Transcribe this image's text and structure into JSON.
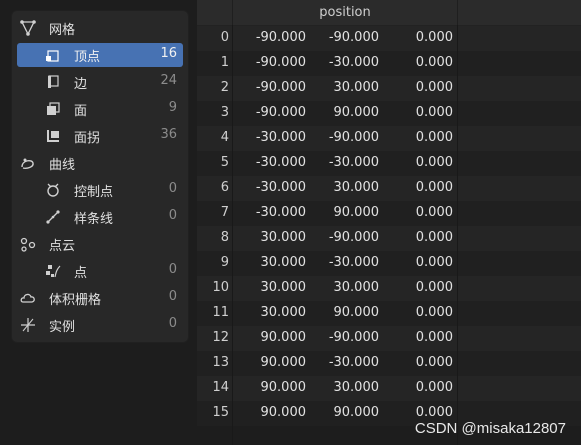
{
  "tree": [
    {
      "key": "mesh",
      "label": "网格",
      "count": "",
      "indent": 0,
      "icon": "mesh-icon",
      "selected": false
    },
    {
      "key": "vertex",
      "label": "顶点",
      "count": "16",
      "indent": 1,
      "icon": "vertex-icon",
      "selected": true
    },
    {
      "key": "edge",
      "label": "边",
      "count": "24",
      "indent": 1,
      "icon": "edge-icon",
      "selected": false
    },
    {
      "key": "face",
      "label": "面",
      "count": "9",
      "indent": 1,
      "icon": "face-icon",
      "selected": false
    },
    {
      "key": "face_corner",
      "label": "面拐",
      "count": "36",
      "indent": 1,
      "icon": "face-corner-icon",
      "selected": false
    },
    {
      "key": "curve",
      "label": "曲线",
      "count": "",
      "indent": 0,
      "icon": "curve-icon",
      "selected": false
    },
    {
      "key": "control_point",
      "label": "控制点",
      "count": "0",
      "indent": 1,
      "icon": "control-point-icon",
      "selected": false
    },
    {
      "key": "spline",
      "label": "样条线",
      "count": "0",
      "indent": 1,
      "icon": "spline-icon",
      "selected": false
    },
    {
      "key": "point_cloud",
      "label": "点云",
      "count": "",
      "indent": 0,
      "icon": "point-cloud-icon",
      "selected": false
    },
    {
      "key": "point",
      "label": "点",
      "count": "0",
      "indent": 1,
      "icon": "point-icon",
      "selected": false
    },
    {
      "key": "volume_grid",
      "label": "体积栅格",
      "count": "0",
      "indent": 0,
      "icon": "volume-icon",
      "selected": false
    },
    {
      "key": "instance",
      "label": "实例",
      "count": "0",
      "indent": 0,
      "icon": "instance-icon",
      "selected": false
    }
  ],
  "table": {
    "header": "position",
    "rows": [
      {
        "i": "0",
        "x": "-90.000",
        "y": "-90.000",
        "z": "0.000"
      },
      {
        "i": "1",
        "x": "-90.000",
        "y": "-30.000",
        "z": "0.000"
      },
      {
        "i": "2",
        "x": "-90.000",
        "y": "30.000",
        "z": "0.000"
      },
      {
        "i": "3",
        "x": "-90.000",
        "y": "90.000",
        "z": "0.000"
      },
      {
        "i": "4",
        "x": "-30.000",
        "y": "-90.000",
        "z": "0.000"
      },
      {
        "i": "5",
        "x": "-30.000",
        "y": "-30.000",
        "z": "0.000"
      },
      {
        "i": "6",
        "x": "-30.000",
        "y": "30.000",
        "z": "0.000"
      },
      {
        "i": "7",
        "x": "-30.000",
        "y": "90.000",
        "z": "0.000"
      },
      {
        "i": "8",
        "x": "30.000",
        "y": "-90.000",
        "z": "0.000"
      },
      {
        "i": "9",
        "x": "30.000",
        "y": "-30.000",
        "z": "0.000"
      },
      {
        "i": "10",
        "x": "30.000",
        "y": "30.000",
        "z": "0.000"
      },
      {
        "i": "11",
        "x": "30.000",
        "y": "90.000",
        "z": "0.000"
      },
      {
        "i": "12",
        "x": "90.000",
        "y": "-90.000",
        "z": "0.000"
      },
      {
        "i": "13",
        "x": "90.000",
        "y": "-30.000",
        "z": "0.000"
      },
      {
        "i": "14",
        "x": "90.000",
        "y": "30.000",
        "z": "0.000"
      },
      {
        "i": "15",
        "x": "90.000",
        "y": "90.000",
        "z": "0.000"
      }
    ]
  },
  "watermark": "CSDN @misaka12807",
  "colors": {
    "selection": "#4772b3",
    "panel": "#282828",
    "background": "#1d1d1d"
  }
}
